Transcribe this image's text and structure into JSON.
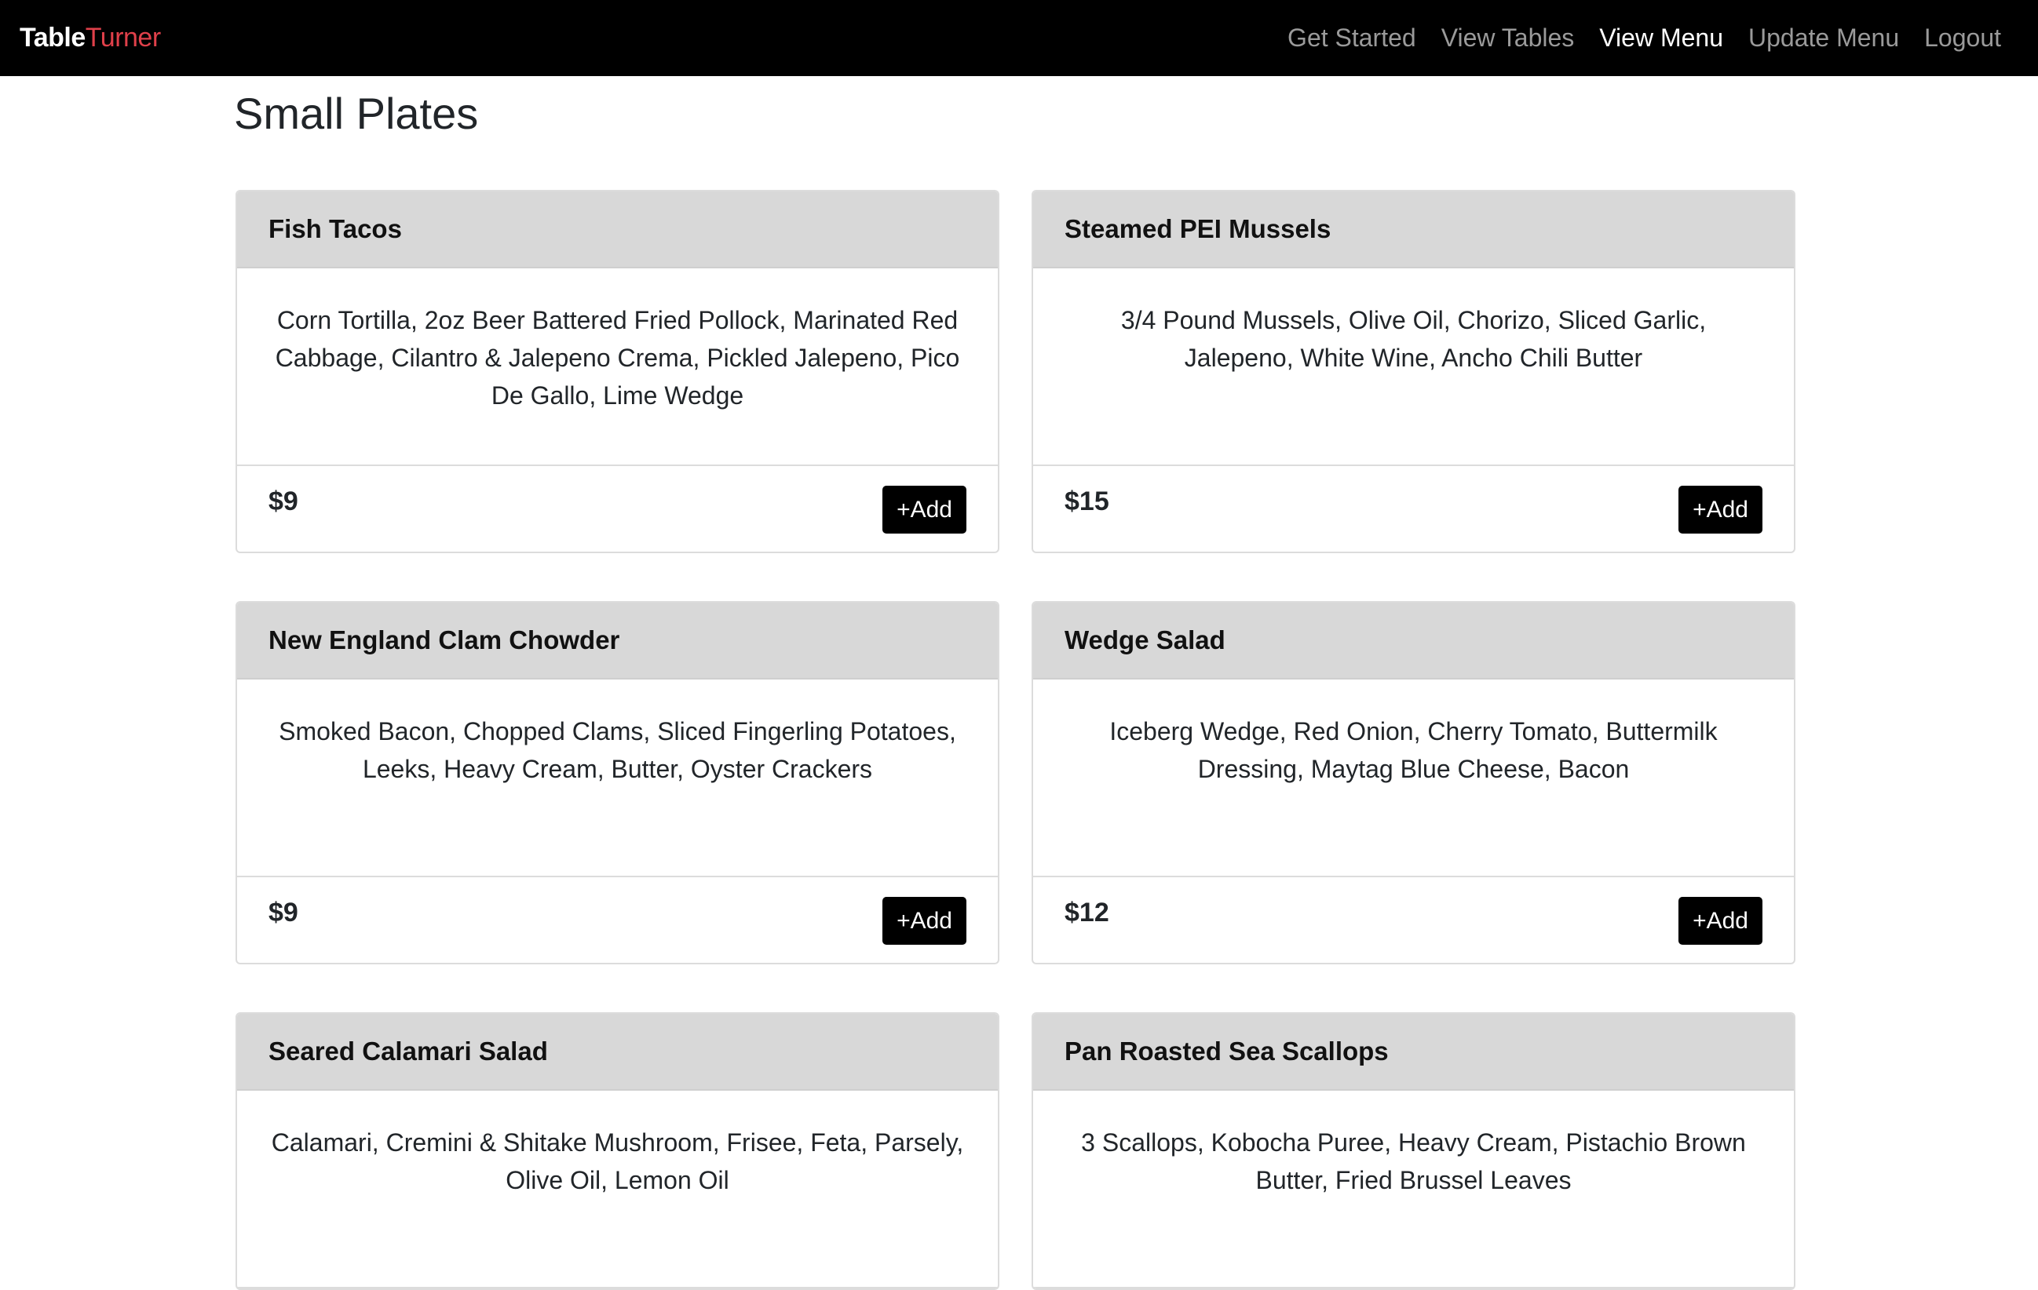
{
  "brand": {
    "part1": "Table",
    "part2": "Turner"
  },
  "nav": {
    "items": [
      {
        "label": "Get Started"
      },
      {
        "label": "View Tables"
      },
      {
        "label": "View Menu"
      },
      {
        "label": "Update Menu"
      },
      {
        "label": "Logout"
      }
    ],
    "active": "View Menu"
  },
  "section": {
    "title": "Small Plates"
  },
  "items": [
    {
      "name": "Fish Tacos",
      "description": "Corn Tortilla, 2oz Beer Battered Fried Pollock, Marinated Red Cabbage, Cilantro & Jalepeno Crema, Pickled Jalepeno, Pico De Gallo, Lime Wedge",
      "price": "$9",
      "add_label": "+Add"
    },
    {
      "name": "Steamed PEI Mussels",
      "description": "3/4 Pound Mussels, Olive Oil, Chorizo, Sliced Garlic, Jalepeno, White Wine, Ancho Chili Butter",
      "price": "$15",
      "add_label": "+Add"
    },
    {
      "name": "New England Clam Chowder",
      "description": "Smoked Bacon, Chopped Clams, Sliced Fingerling Potatoes, Leeks, Heavy Cream, Butter, Oyster Crackers",
      "price": "$9",
      "add_label": "+Add"
    },
    {
      "name": "Wedge Salad",
      "description": "Iceberg Wedge, Red Onion, Cherry Tomato, Buttermilk Dressing, Maytag Blue Cheese, Bacon",
      "price": "$12",
      "add_label": "+Add"
    },
    {
      "name": "Seared Calamari Salad",
      "description": "Calamari, Cremini & Shitake Mushroom, Frisee, Feta, Parsely, Olive Oil, Lemon Oil"
    },
    {
      "name": "Pan Roasted Sea Scallops",
      "description": "3 Scallops, Kobocha Puree, Heavy Cream, Pistachio Brown Butter, Fried Brussel Leaves"
    }
  ],
  "colors": {
    "navbar": "#000000",
    "brand_accent": "#e0404a",
    "card_header": "#d8d8d8",
    "button": "#000000"
  }
}
